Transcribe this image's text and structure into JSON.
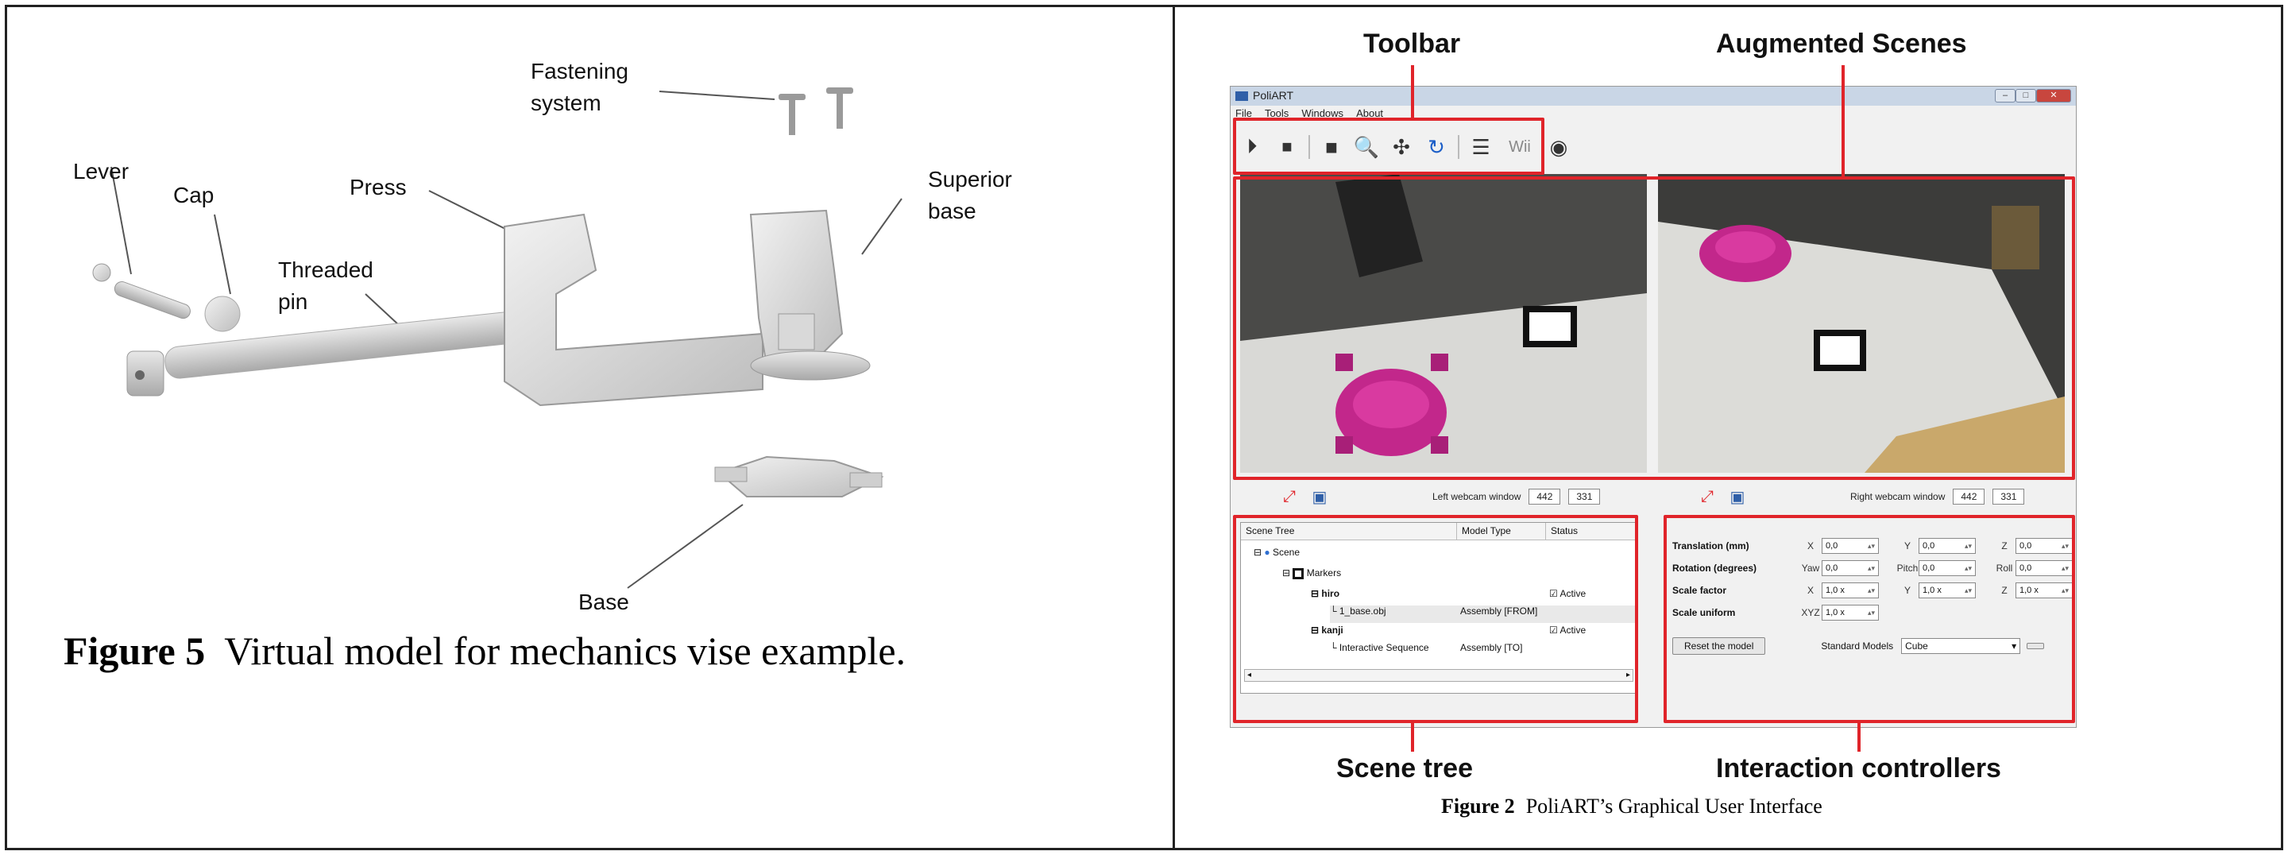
{
  "left": {
    "callouts": {
      "fastening": "Fastening\nsystem",
      "lever": "Lever",
      "cap": "Cap",
      "press": "Press",
      "threaded_pin": "Threaded\npin",
      "superior_base": "Superior\nbase",
      "base": "Base"
    },
    "caption": {
      "label": "Figure 5",
      "text": "Virtual model for mechanics vise example."
    }
  },
  "right": {
    "annotations": {
      "toolbar": "Toolbar",
      "augmented_scenes": "Augmented Scenes",
      "scene_tree": "Scene tree",
      "interaction_controllers": "Interaction controllers"
    },
    "app": {
      "title": "PoliART",
      "menu": [
        "File",
        "Tools",
        "Windows",
        "About"
      ],
      "toolbar_icons": [
        "play-icon",
        "stop-icon",
        "marker-icon",
        "magnifier-icon",
        "axes-icon",
        "rotate-icon",
        "list-icon",
        "wii-icon",
        "webcam-icon"
      ],
      "wii_label": "Wii",
      "left_cam": {
        "label": "Left webcam window",
        "w": "442",
        "h": "331"
      },
      "right_cam": {
        "label": "Right webcam window",
        "w": "442",
        "h": "331"
      },
      "scene_tree": {
        "headers": [
          "Scene Tree",
          "Model Type",
          "Status"
        ],
        "rows": [
          {
            "name": "Scene",
            "type": "",
            "status": ""
          },
          {
            "name": "Markers",
            "type": "",
            "status": ""
          },
          {
            "name": "hiro",
            "type": "",
            "status": "Active"
          },
          {
            "name": "1_base.obj",
            "type": "Assembly [FROM]",
            "status": ""
          },
          {
            "name": "kanji",
            "type": "",
            "status": "Active"
          },
          {
            "name": "Interactive Sequence",
            "type": "Assembly [TO]",
            "status": ""
          }
        ]
      },
      "controllers": {
        "translation": {
          "label": "Translation (mm)",
          "axes": [
            "X",
            "Y",
            "Z"
          ],
          "values": [
            "0,0",
            "0,0",
            "0,0"
          ]
        },
        "rotation": {
          "label": "Rotation (degrees)",
          "axes": [
            "Yaw",
            "Pitch",
            "Roll"
          ],
          "values": [
            "0,0",
            "0,0",
            "0,0"
          ]
        },
        "scale": {
          "label": "Scale factor",
          "axes": [
            "X",
            "Y",
            "Z"
          ],
          "values": [
            "1,0 x",
            "1,0 x",
            "1,0 x"
          ]
        },
        "scale_uniform": {
          "label": "Scale uniform",
          "axis": "XYZ",
          "value": "1,0 x"
        },
        "reset_label": "Reset the model",
        "standard_models_label": "Standard Models",
        "standard_models_value": "Cube"
      }
    },
    "caption": {
      "label": "Figure 2",
      "text": "PoliART’s Graphical User Interface"
    }
  }
}
